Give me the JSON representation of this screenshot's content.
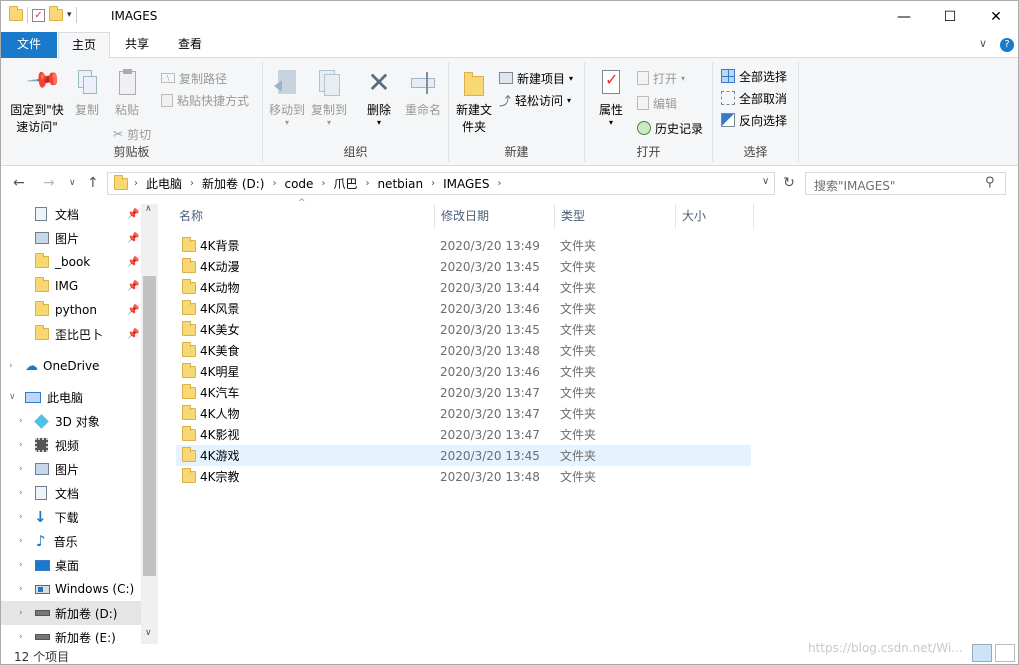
{
  "window": {
    "title": "IMAGES",
    "minimize": "—",
    "maximize": "☐",
    "close": "✕"
  },
  "ribbon_tabs": [
    "文件",
    "主页",
    "共享",
    "查看"
  ],
  "ribbon": {
    "clipboard": {
      "pin_label": "固定到\"快速访问\"",
      "copy": "复制",
      "paste": "粘贴",
      "copy_path": "复制路径",
      "paste_shortcut": "粘贴快捷方式",
      "cut": "剪切",
      "group": "剪贴板"
    },
    "organize": {
      "move_to": "移动到",
      "copy_to": "复制到",
      "delete": "删除",
      "rename": "重命名",
      "group": "组织"
    },
    "new": {
      "new_folder": "新建文件夹",
      "new_item": "新建项目",
      "easy_access": "轻松访问",
      "group": "新建"
    },
    "open": {
      "properties": "属性",
      "open": "打开",
      "edit": "编辑",
      "history": "历史记录",
      "group": "打开"
    },
    "select": {
      "select_all": "全部选择",
      "select_none": "全部取消",
      "invert": "反向选择",
      "group": "选择"
    }
  },
  "address": {
    "breadcrumbs": [
      "此电脑",
      "新加卷 (D:)",
      "code",
      "爪巴",
      "netbian",
      "IMAGES"
    ],
    "search_placeholder": "搜索\"IMAGES\""
  },
  "nav_pane": {
    "quick_access": [
      "文档",
      "图片",
      "_book",
      "IMG",
      "python",
      "歪比巴卜"
    ],
    "onedrive": "OneDrive",
    "this_pc": "此电脑",
    "pc_items": [
      "3D 对象",
      "视频",
      "图片",
      "文档",
      "下载",
      "音乐",
      "桌面",
      "Windows (C:)",
      "新加卷 (D:)",
      "新加卷 (E:)"
    ]
  },
  "columns": {
    "name": "名称",
    "date": "修改日期",
    "type": "类型",
    "size": "大小"
  },
  "files": [
    {
      "name": "4K背景",
      "date": "2020/3/20 13:49",
      "type": "文件夹"
    },
    {
      "name": "4K动漫",
      "date": "2020/3/20 13:45",
      "type": "文件夹"
    },
    {
      "name": "4K动物",
      "date": "2020/3/20 13:44",
      "type": "文件夹"
    },
    {
      "name": "4K风景",
      "date": "2020/3/20 13:46",
      "type": "文件夹"
    },
    {
      "name": "4K美女",
      "date": "2020/3/20 13:45",
      "type": "文件夹"
    },
    {
      "name": "4K美食",
      "date": "2020/3/20 13:48",
      "type": "文件夹"
    },
    {
      "name": "4K明星",
      "date": "2020/3/20 13:46",
      "type": "文件夹"
    },
    {
      "name": "4K汽车",
      "date": "2020/3/20 13:47",
      "type": "文件夹"
    },
    {
      "name": "4K人物",
      "date": "2020/3/20 13:47",
      "type": "文件夹"
    },
    {
      "name": "4K影视",
      "date": "2020/3/20 13:47",
      "type": "文件夹"
    },
    {
      "name": "4K游戏",
      "date": "2020/3/20 13:45",
      "type": "文件夹"
    },
    {
      "name": "4K宗教",
      "date": "2020/3/20 13:48",
      "type": "文件夹"
    }
  ],
  "highlighted_row": 10,
  "status": {
    "count": "12 个项目",
    "watermark": "https://blog.csdn.net/Wi..."
  }
}
